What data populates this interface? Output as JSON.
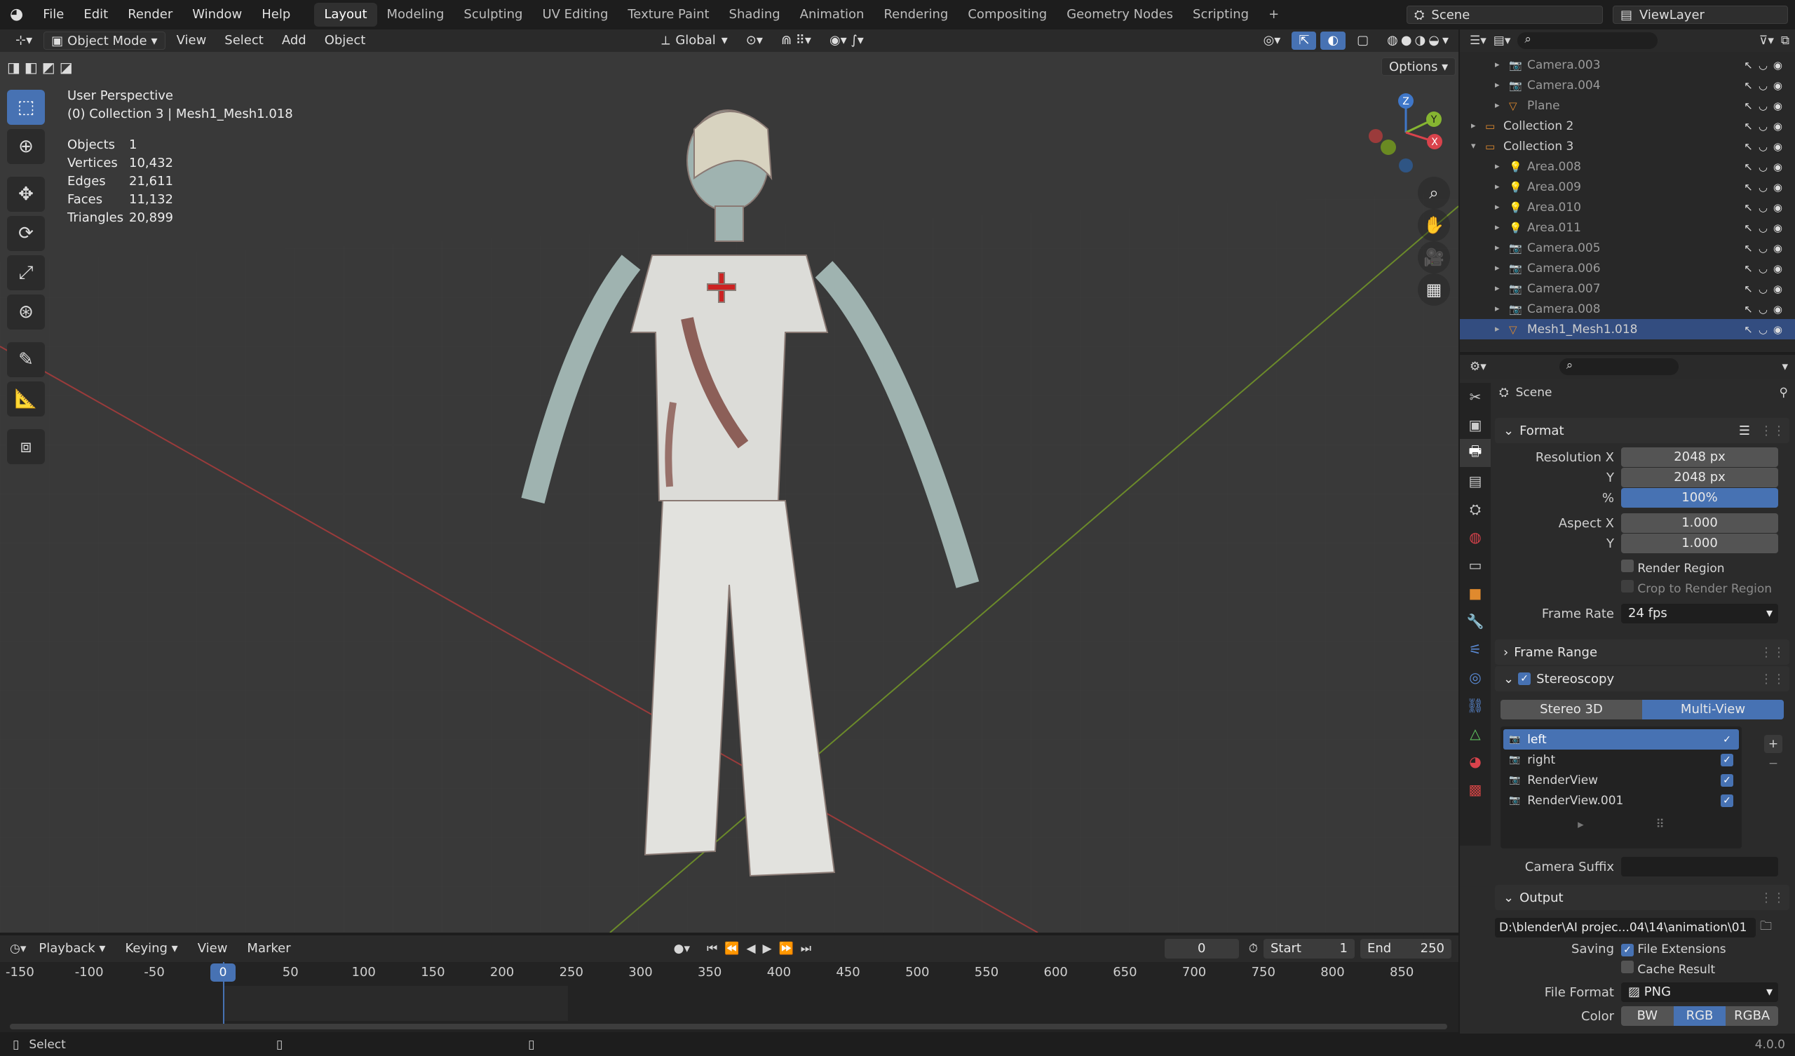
{
  "topbar": {
    "menus": [
      "File",
      "Edit",
      "Render",
      "Window",
      "Help"
    ],
    "workspaces": [
      "Layout",
      "Modeling",
      "Sculpting",
      "UV Editing",
      "Texture Paint",
      "Shading",
      "Animation",
      "Rendering",
      "Compositing",
      "Geometry Nodes",
      "Scripting"
    ],
    "add_tab": "+",
    "scene": "Scene",
    "view_layer": "ViewLayer"
  },
  "viewport_header": {
    "mode": "Object Mode",
    "menus": [
      "View",
      "Select",
      "Add",
      "Object"
    ],
    "orientation": "Global",
    "options": "Options"
  },
  "viewport": {
    "perspective": "User Perspective",
    "collection_info": "(0) Collection 3 | Mesh1_Mesh1.018",
    "stats": [
      {
        "k": "Objects",
        "v": "1"
      },
      {
        "k": "Vertices",
        "v": "10,432"
      },
      {
        "k": "Edges",
        "v": "21,611"
      },
      {
        "k": "Faces",
        "v": "11,132"
      },
      {
        "k": "Triangles",
        "v": "20,899"
      }
    ],
    "gizmo": {
      "z": "Z",
      "y": "Y",
      "x": "X"
    }
  },
  "outliner": {
    "rows": [
      {
        "label": "Camera.003",
        "dim": true
      },
      {
        "label": "Camera.004",
        "dim": true
      },
      {
        "label": "Plane",
        "dim": true
      },
      {
        "label": "Collection 2",
        "dim": false
      },
      {
        "label": "Collection 3",
        "dim": false
      },
      {
        "label": "Area.008",
        "dim": true
      },
      {
        "label": "Area.009",
        "dim": true
      },
      {
        "label": "Area.010",
        "dim": true
      },
      {
        "label": "Area.011",
        "dim": true
      },
      {
        "label": "Camera.005",
        "dim": true
      },
      {
        "label": "Camera.006",
        "dim": true
      },
      {
        "label": "Camera.007",
        "dim": true
      },
      {
        "label": "Camera.008",
        "dim": true
      },
      {
        "label": "Mesh1_Mesh1.018",
        "dim": false
      }
    ]
  },
  "properties": {
    "context": "Scene",
    "format": {
      "title": "Format",
      "res_x_label": "Resolution X",
      "res_x": "2048 px",
      "res_y_label": "Y",
      "res_y": "2048 px",
      "pct_label": "%",
      "pct": "100%",
      "aspect_x_label": "Aspect X",
      "aspect_x": "1.000",
      "aspect_y_label": "Y",
      "aspect_y": "1.000",
      "render_region": "Render Region",
      "crop": "Crop to Render Region",
      "frame_rate_label": "Frame Rate",
      "frame_rate": "24 fps"
    },
    "frame_range": "Frame Range",
    "stereoscopy": {
      "title": "Stereoscopy",
      "tab_stereo": "Stereo 3D",
      "tab_multi": "Multi-View",
      "views": [
        "left",
        "right",
        "RenderView",
        "RenderView.001"
      ],
      "camera_suffix_label": "Camera Suffix"
    },
    "output": {
      "title": "Output",
      "path": "D:\\blender\\AI projec...04\\14\\animation\\01",
      "saving_label": "Saving",
      "file_ext": "File Extensions",
      "cache": "Cache Result",
      "format_label": "File Format",
      "format": "PNG",
      "color_label": "Color",
      "color_opts": [
        "BW",
        "RGB",
        "RGBA"
      ]
    }
  },
  "timeline": {
    "menus": [
      "Playback",
      "Keying",
      "View",
      "Marker"
    ],
    "current": "0",
    "start_label": "Start",
    "start": "1",
    "end_label": "End",
    "end": "250",
    "ruler": [
      "-150",
      "-100",
      "-50",
      "0",
      "50",
      "100",
      "150",
      "200",
      "250",
      "300",
      "350",
      "400",
      "450",
      "500",
      "550",
      "600",
      "650",
      "700",
      "750",
      "800",
      "850"
    ]
  },
  "status": {
    "left": "Select",
    "version": "4.0.0"
  }
}
